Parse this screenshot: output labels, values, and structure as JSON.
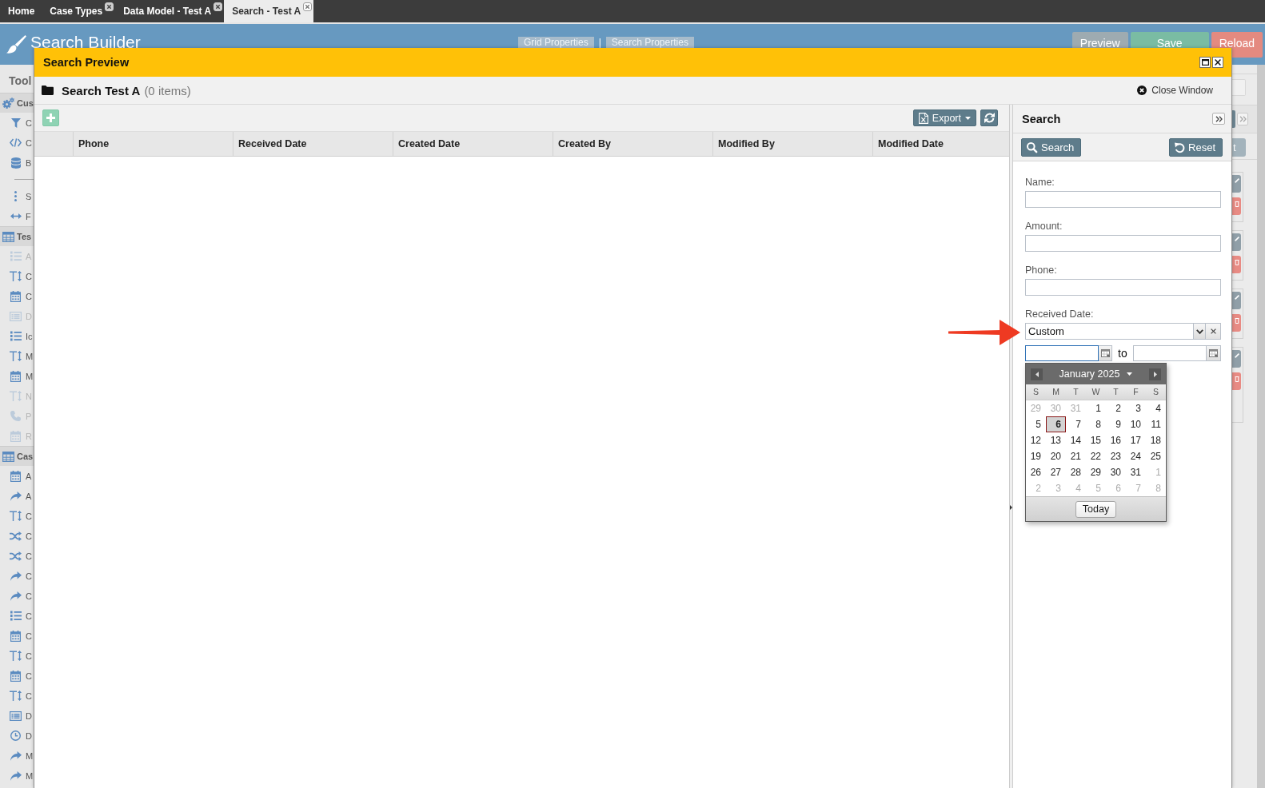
{
  "tabs": [
    {
      "label": "Home",
      "closable": false,
      "selected": false
    },
    {
      "label": "Case Types",
      "closable": true,
      "selected": false
    },
    {
      "label": "Data Model - Test A",
      "closable": true,
      "selected": false
    },
    {
      "label": "Search - Test A",
      "closable": true,
      "selected": true
    }
  ],
  "builder": {
    "title": "Search Builder",
    "view_buttons": [
      "Grid Properties",
      "Search Properties"
    ],
    "view_separator": "|",
    "actions": [
      {
        "label": "Preview",
        "kind": "neutral"
      },
      {
        "label": "Save",
        "kind": "success"
      },
      {
        "label": "Reload",
        "kind": "danger"
      }
    ],
    "side_panel_button": "t"
  },
  "toolbox": {
    "title": "Tool",
    "sections": [
      {
        "label": "Cus",
        "items": [
          {
            "kind": "item",
            "label": "C",
            "disabled": false
          },
          {
            "kind": "item",
            "label": "C",
            "disabled": false
          },
          {
            "kind": "item",
            "label": "B",
            "disabled": false
          },
          {
            "kind": "divider"
          },
          {
            "kind": "item",
            "label": "S",
            "disabled": false
          },
          {
            "kind": "item",
            "label": "F",
            "disabled": false
          }
        ]
      },
      {
        "label": "Tes",
        "items": [
          {
            "kind": "item",
            "label": "A",
            "disabled": true
          },
          {
            "kind": "item",
            "label": "C",
            "disabled": false
          },
          {
            "kind": "item",
            "label": "C",
            "disabled": false
          },
          {
            "kind": "item",
            "label": "D",
            "disabled": true
          },
          {
            "kind": "item",
            "label": "Ic",
            "disabled": false
          },
          {
            "kind": "item",
            "label": "M",
            "disabled": false
          },
          {
            "kind": "item",
            "label": "M",
            "disabled": false
          },
          {
            "kind": "item",
            "label": "N",
            "disabled": true
          },
          {
            "kind": "item",
            "label": "P",
            "disabled": true
          },
          {
            "kind": "item",
            "label": "R",
            "disabled": true
          }
        ]
      },
      {
        "label": "Cas",
        "items": [
          {
            "kind": "item",
            "label": "A",
            "disabled": false
          },
          {
            "kind": "item",
            "label": "A",
            "disabled": false
          },
          {
            "kind": "item",
            "label": "C",
            "disabled": false
          },
          {
            "kind": "item",
            "label": "C",
            "disabled": false
          },
          {
            "kind": "item",
            "label": "C",
            "disabled": false
          },
          {
            "kind": "item",
            "label": "C",
            "disabled": false
          },
          {
            "kind": "item",
            "label": "C",
            "disabled": false
          },
          {
            "kind": "item",
            "label": "C",
            "disabled": false
          },
          {
            "kind": "item",
            "label": "C",
            "disabled": false
          },
          {
            "kind": "item",
            "label": "C",
            "disabled": false
          },
          {
            "kind": "item",
            "label": "C",
            "disabled": false
          },
          {
            "kind": "item",
            "label": "C",
            "disabled": false
          },
          {
            "kind": "item",
            "label": "D",
            "disabled": false
          },
          {
            "kind": "item",
            "label": "D",
            "disabled": false
          },
          {
            "kind": "item",
            "label": "M",
            "disabled": false
          },
          {
            "kind": "item",
            "label": "M",
            "disabled": false
          }
        ]
      }
    ]
  },
  "preview": {
    "title": "Search Preview",
    "heading": "Search Test A",
    "count": "(0 items)",
    "close_label": "Close Window",
    "grid": {
      "export_label": "Export",
      "columns": [
        "Phone",
        "Received Date",
        "Created Date",
        "Created By",
        "Modified By",
        "Modified Date"
      ]
    },
    "search": {
      "title": "Search",
      "actions": [
        {
          "label": "Search",
          "kind": "search"
        },
        {
          "label": "Reset",
          "kind": "reset"
        }
      ],
      "fields": [
        {
          "kind": "text",
          "label": "Name:"
        },
        {
          "kind": "text",
          "label": "Amount:"
        },
        {
          "kind": "text",
          "label": "Phone:"
        },
        {
          "kind": "date_range",
          "label": "Received Date:",
          "value": "Custom",
          "separator": "to",
          "from_focused": true,
          "to_focused": false,
          "calendar": {
            "month": "January 2025",
            "weekdays": [
              "S",
              "M",
              "T",
              "W",
              "T",
              "F",
              "S"
            ],
            "days": [
              {
                "label": "29",
                "outside": true,
                "selected": false
              },
              {
                "label": "30",
                "outside": true,
                "selected": false
              },
              {
                "label": "31",
                "outside": true,
                "selected": false
              },
              {
                "label": "1",
                "outside": false,
                "selected": false
              },
              {
                "label": "2",
                "outside": false,
                "selected": false
              },
              {
                "label": "3",
                "outside": false,
                "selected": false
              },
              {
                "label": "4",
                "outside": false,
                "selected": false
              },
              {
                "label": "5",
                "outside": false,
                "selected": false
              },
              {
                "label": "6",
                "outside": false,
                "selected": true
              },
              {
                "label": "7",
                "outside": false,
                "selected": false
              },
              {
                "label": "8",
                "outside": false,
                "selected": false
              },
              {
                "label": "9",
                "outside": false,
                "selected": false
              },
              {
                "label": "10",
                "outside": false,
                "selected": false
              },
              {
                "label": "11",
                "outside": false,
                "selected": false
              },
              {
                "label": "12",
                "outside": false,
                "selected": false
              },
              {
                "label": "13",
                "outside": false,
                "selected": false
              },
              {
                "label": "14",
                "outside": false,
                "selected": false
              },
              {
                "label": "15",
                "outside": false,
                "selected": false
              },
              {
                "label": "16",
                "outside": false,
                "selected": false
              },
              {
                "label": "17",
                "outside": false,
                "selected": false
              },
              {
                "label": "18",
                "outside": false,
                "selected": false
              },
              {
                "label": "19",
                "outside": false,
                "selected": false
              },
              {
                "label": "20",
                "outside": false,
                "selected": false
              },
              {
                "label": "21",
                "outside": false,
                "selected": false
              },
              {
                "label": "22",
                "outside": false,
                "selected": false
              },
              {
                "label": "23",
                "outside": false,
                "selected": false
              },
              {
                "label": "24",
                "outside": false,
                "selected": false
              },
              {
                "label": "25",
                "outside": false,
                "selected": false
              },
              {
                "label": "26",
                "outside": false,
                "selected": false
              },
              {
                "label": "27",
                "outside": false,
                "selected": false
              },
              {
                "label": "28",
                "outside": false,
                "selected": false
              },
              {
                "label": "29",
                "outside": false,
                "selected": false
              },
              {
                "label": "30",
                "outside": false,
                "selected": false
              },
              {
                "label": "31",
                "outside": false,
                "selected": false
              },
              {
                "label": "1",
                "outside": true,
                "selected": false
              },
              {
                "label": "2",
                "outside": true,
                "selected": false
              },
              {
                "label": "3",
                "outside": true,
                "selected": false
              },
              {
                "label": "4",
                "outside": true,
                "selected": false
              },
              {
                "label": "5",
                "outside": true,
                "selected": false
              },
              {
                "label": "6",
                "outside": true,
                "selected": false
              },
              {
                "label": "7",
                "outside": true,
                "selected": false
              },
              {
                "label": "8",
                "outside": true,
                "selected": false
              }
            ],
            "today_label": "Today"
          }
        }
      ]
    }
  }
}
